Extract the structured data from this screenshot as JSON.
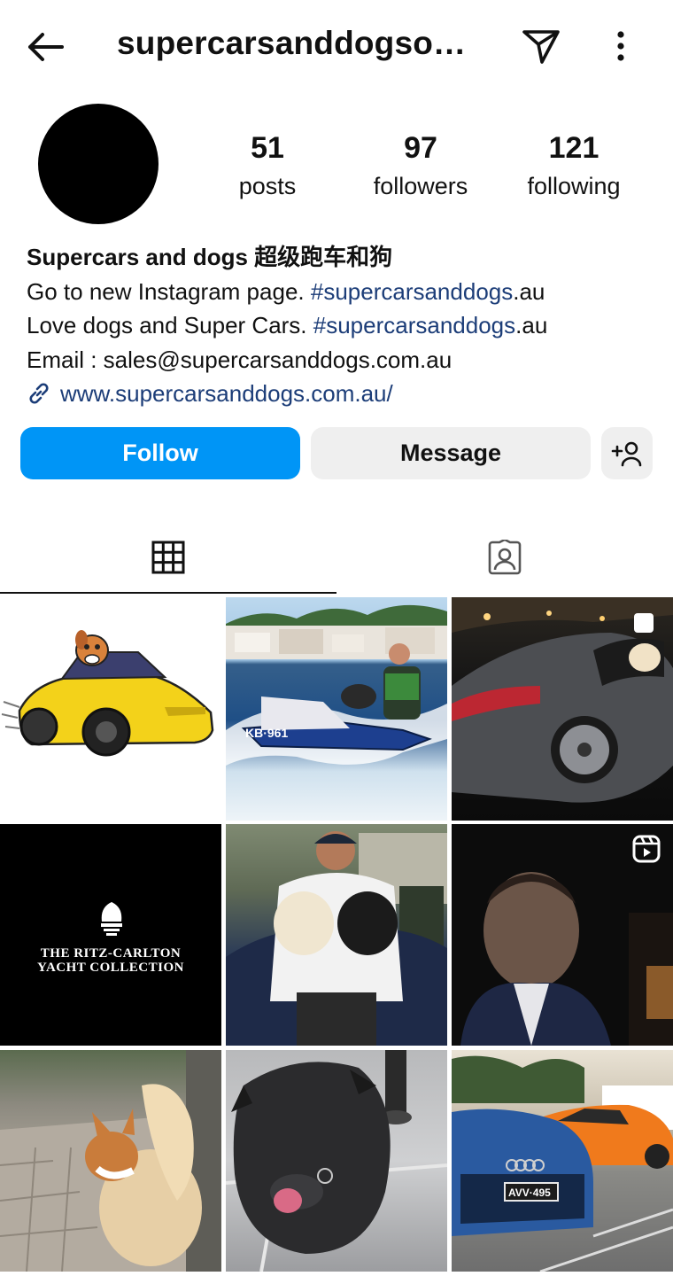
{
  "header": {
    "username": "supercarsanddogso…",
    "back_icon": "arrow-left-icon",
    "dm_icon": "paper-plane-icon",
    "more_icon": "more-vertical-icon"
  },
  "profile": {
    "stats": [
      {
        "value": "51",
        "label": "posts"
      },
      {
        "value": "97",
        "label": "followers"
      },
      {
        "value": "121",
        "label": "following"
      }
    ],
    "bio": {
      "name": "Supercars and dogs 超级跑车和狗",
      "line1_text": "Go to new Instagram page. ",
      "line1_tag": "#supercarsanddogs",
      "line1_suffix": ".au",
      "line2_text": "Love  dogs and Super Cars. ",
      "line2_tag": "#supercarsanddogs",
      "line2_suffix": ".au",
      "email": "Email : sales@supercarsanddogs.com.au",
      "website": "www.supercarsanddogs.com.au/"
    }
  },
  "actions": {
    "follow_label": "Follow",
    "message_label": "Message",
    "suggest_icon": "add-person-icon"
  },
  "tabs": [
    {
      "name": "posts-grid",
      "icon": "grid-icon"
    },
    {
      "name": "tagged",
      "icon": "tagged-person-icon"
    }
  ],
  "posts": [
    {
      "desc": "Cartoon dog driving yellow supercar"
    },
    {
      "desc": "Man and dog on jet ski"
    },
    {
      "desc": "Dog in grey sports car at night",
      "badge": "multi-photo"
    },
    {
      "caption_line1": "THE RITZ-CARLTON",
      "caption_line2": "YACHT COLLECTION"
    },
    {
      "desc": "Man holding two fluffy dogs"
    },
    {
      "desc": "Man in dark car",
      "badge": "reels"
    },
    {
      "desc": "Corgi dog on footpath"
    },
    {
      "desc": "Black dog with tongue out"
    },
    {
      "desc": "Audi and orange Lamborghini",
      "plate": "AVV·495"
    }
  ],
  "colors": {
    "follow_blue": "#0095f6",
    "link_blue": "#1c3d78",
    "button_grey": "#efefef"
  }
}
